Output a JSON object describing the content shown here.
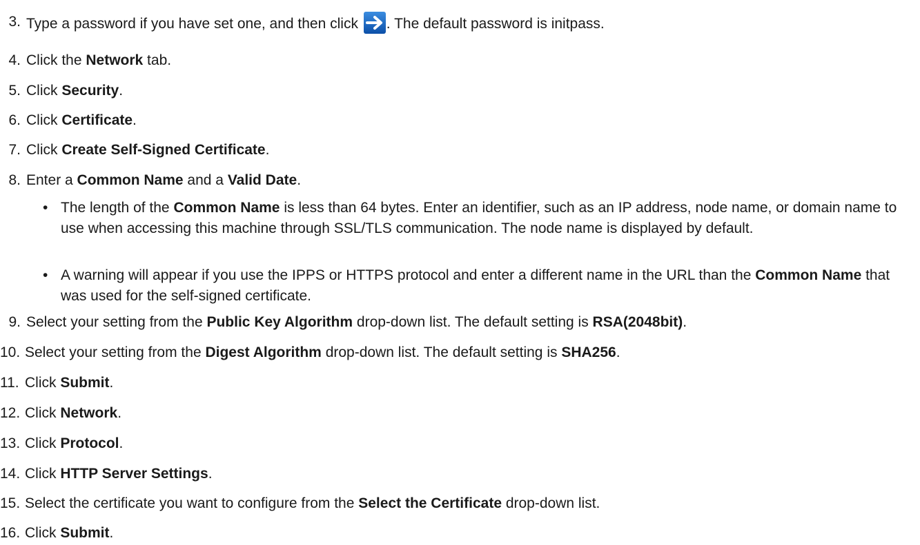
{
  "steps": [
    {
      "num": "3.",
      "parts": [
        "Type a password if you have set one, and then click ",
        ". The default password is initpass."
      ]
    },
    {
      "num": "4.",
      "parts": [
        "Click the ",
        "Network",
        " tab."
      ]
    },
    {
      "num": "5.",
      "parts": [
        "Click ",
        "Security",
        "."
      ]
    },
    {
      "num": "6.",
      "parts": [
        "Click ",
        "Certificate",
        "."
      ]
    },
    {
      "num": "7.",
      "parts": [
        "Click ",
        "Create Self-Signed Certificate",
        "."
      ]
    },
    {
      "num": "8.",
      "parts": [
        "Enter a ",
        "Common Name",
        " and a ",
        "Valid Date",
        "."
      ]
    },
    {
      "num": "9.",
      "parts": [
        "Select your setting from the ",
        "Public Key Algorithm",
        " drop-down list. The default setting is ",
        "RSA(2048bit)",
        "."
      ]
    },
    {
      "num": "10.",
      "parts": [
        "Select your setting from the ",
        "Digest Algorithm",
        " drop-down list. The default setting is ",
        "SHA256",
        "."
      ]
    },
    {
      "num": "11.",
      "parts": [
        "Click ",
        "Submit",
        "."
      ]
    },
    {
      "num": "12.",
      "parts": [
        "Click ",
        "Network",
        "."
      ]
    },
    {
      "num": "13.",
      "parts": [
        "Click ",
        "Protocol",
        "."
      ]
    },
    {
      "num": "14.",
      "parts": [
        "Click ",
        "HTTP Server Settings",
        "."
      ]
    },
    {
      "num": "15.",
      "parts": [
        "Select the certificate you want to configure from the ",
        "Select the Certificate",
        " drop-down list."
      ]
    },
    {
      "num": "16.",
      "parts": [
        "Click ",
        "Submit",
        "."
      ]
    }
  ],
  "bullets": [
    {
      "dot": "•",
      "parts": [
        "The length of the ",
        "Common Name",
        " is less than 64 bytes. Enter an identifier, such as an IP address, node name, or domain name to use when accessing this machine through SSL/TLS communication. The node name is displayed by default."
      ]
    },
    {
      "dot": "•",
      "parts": [
        "A warning will appear if you use the IPPS or HTTPS protocol and enter a different name in the URL than the ",
        "Common Name",
        " that was used for the self-signed certificate."
      ]
    }
  ],
  "icons": {
    "login_arrow": "arrow-right-icon",
    "login_arrow_bg": "#1a5fb4"
  }
}
